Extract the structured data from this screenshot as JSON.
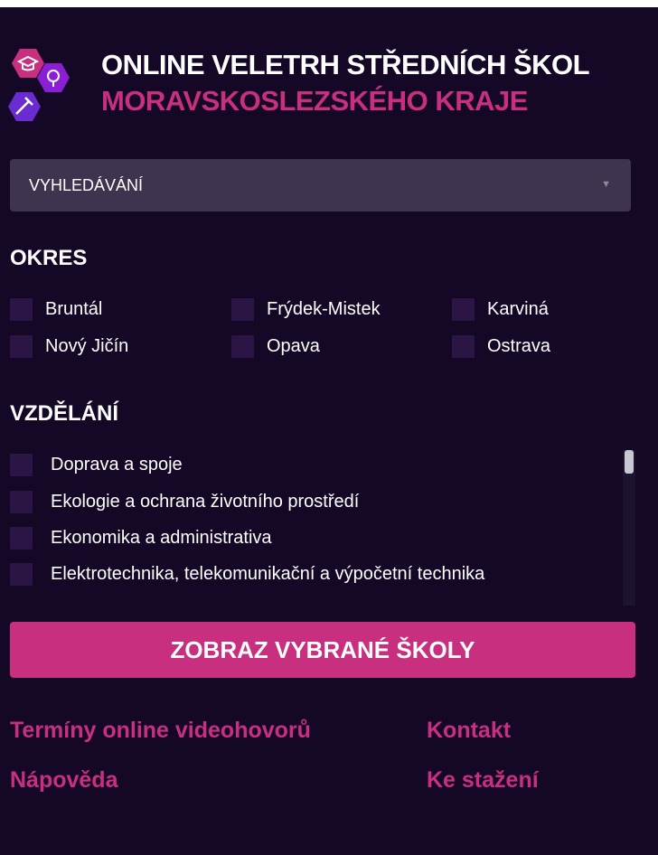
{
  "header": {
    "title_line1": "ONLINE VELETRH STŘEDNÍCH ŠKOL",
    "title_line2": "MORAVSKOSLEZSKÉHO KRAJE"
  },
  "search": {
    "label": "VYHLEDÁVÁNÍ",
    "caret": "▼"
  },
  "okres": {
    "heading": "OKRES",
    "items": [
      "Bruntál",
      "Frýdek-Mistek",
      "Karviná",
      "Nový Jičín",
      "Opava",
      "Ostrava"
    ]
  },
  "vzdelani": {
    "heading": "VZDĚLÁNÍ",
    "items": [
      "Doprava a spoje",
      "Ekologie a ochrana životního prostředí",
      "Ekonomika a administrativa",
      "Elektrotechnika, telekomunikační a výpočetní technika"
    ]
  },
  "submit_label": "ZOBRAZ VYBRANÉ ŠKOLY",
  "footer": {
    "links": [
      "Termíny online videohovorů",
      "Kontakt",
      "Nápověda",
      "Ke stažení"
    ]
  },
  "colors": {
    "background": "#150827",
    "accent": "#c8307f",
    "select_bg": "#3e3450",
    "checkbox_bg": "#2b1545"
  }
}
